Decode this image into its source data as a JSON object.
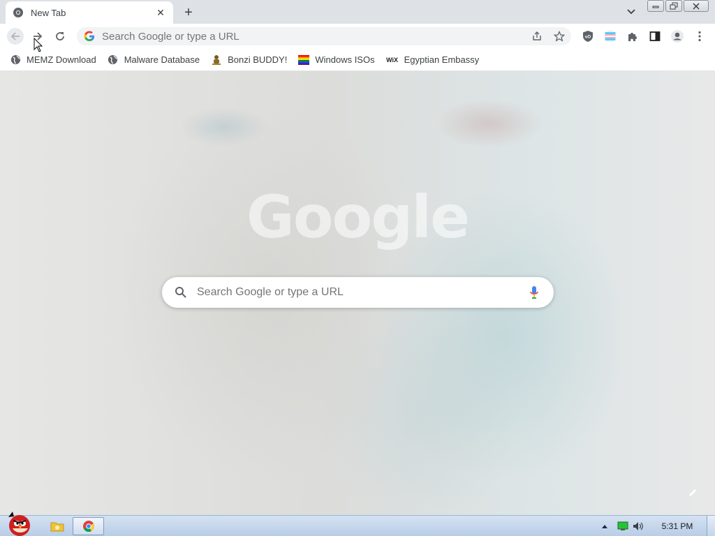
{
  "tab": {
    "title": "New Tab",
    "close_glyph": "✕"
  },
  "newtab_glyph": "+",
  "toolbar": {
    "omnibox_placeholder": "Search Google or type a URL",
    "icons": [
      "back-icon",
      "forward-icon",
      "reload-icon",
      "share-icon",
      "star-icon",
      "ublock-icon",
      "flag-icon",
      "puzzle-icon",
      "sidepanel-icon",
      "profile-icon",
      "kebab-icon"
    ]
  },
  "bookmarks": [
    {
      "label": "MEMZ Download",
      "icon": "globe-icon"
    },
    {
      "label": "Malware Database",
      "icon": "globe-icon"
    },
    {
      "label": "Bonzi BUDDY!",
      "icon": "bonzi-icon"
    },
    {
      "label": "Windows ISOs",
      "icon": "rainbow-flag-icon"
    },
    {
      "label": "Egyptian Embassy",
      "icon": "wix-icon",
      "icon_text": "WiX"
    }
  ],
  "content": {
    "logo_text": "Google",
    "search_placeholder": "Search Google or type a URL"
  },
  "taskbar": {
    "clock": "5:31 PM"
  },
  "colors": {
    "accent_blue": "#4285f4",
    "red": "#ea4335",
    "yellow": "#fbbc05",
    "green": "#34a853",
    "chrome_text": "#3c4043"
  }
}
